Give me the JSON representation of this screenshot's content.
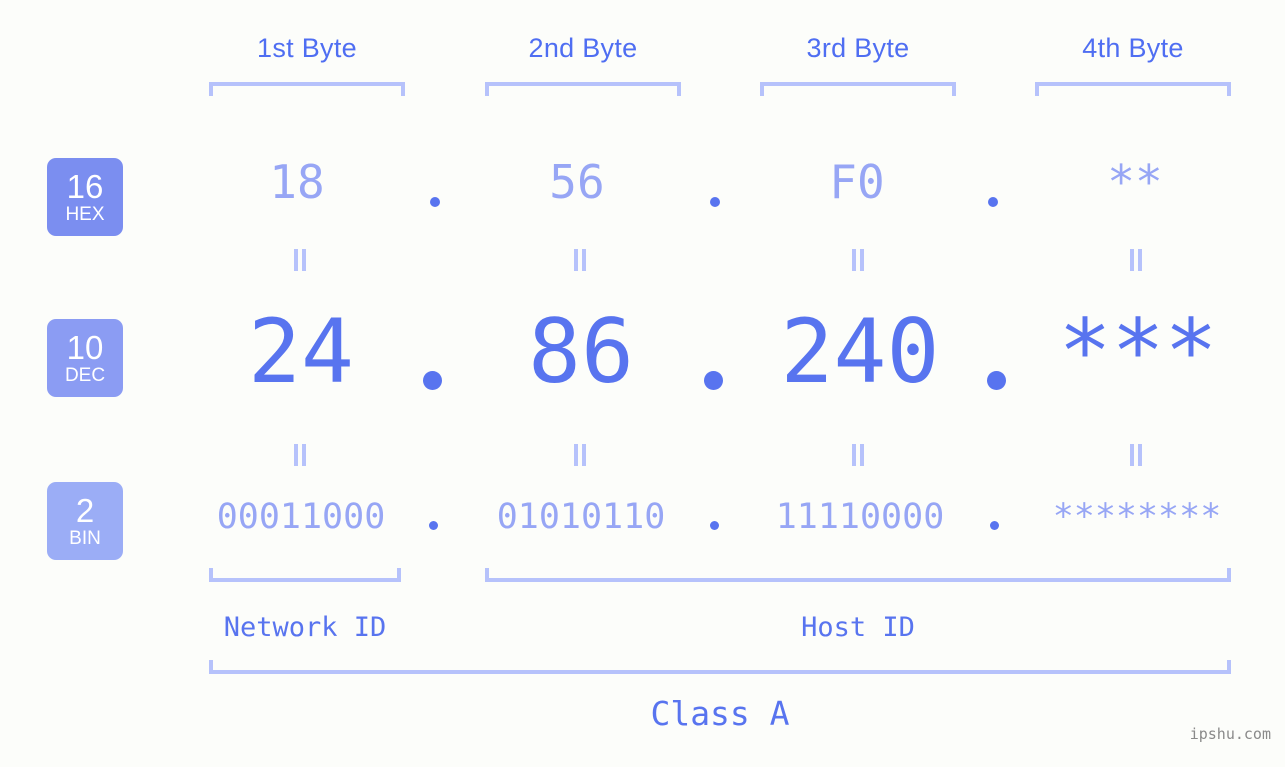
{
  "watermark": "ipshu.com",
  "colors": {
    "background": "#fcfdfa",
    "accent_strong": "#4f6ef2",
    "accent_mid": "#5874ef",
    "accent_light": "#97a6f5",
    "bracket": "#b6c2fb",
    "badge_hex": "#7b8ef0",
    "badge_dec": "#8b9cf3",
    "badge_bin": "#9badf6",
    "watermark_text": "#8a8a8a"
  },
  "byte_headers": [
    {
      "label": "1st Byte"
    },
    {
      "label": "2nd Byte"
    },
    {
      "label": "3rd Byte"
    },
    {
      "label": "4th Byte"
    }
  ],
  "bases": [
    {
      "number": "16",
      "name": "HEX"
    },
    {
      "number": "10",
      "name": "DEC"
    },
    {
      "number": "2",
      "name": "BIN"
    }
  ],
  "rows": {
    "hex": {
      "base": "16",
      "name": "HEX",
      "values": [
        "18",
        "56",
        "F0",
        "**"
      ]
    },
    "dec": {
      "base": "10",
      "name": "DEC",
      "values": [
        "24",
        "86",
        "240",
        "***"
      ]
    },
    "bin": {
      "base": "2",
      "name": "BIN",
      "values": [
        "00011000",
        "01010110",
        "11110000",
        "********"
      ]
    }
  },
  "separator": {
    "glyph": ".",
    "count_per_row": 3
  },
  "equals_marks": {
    "glyph": "‖",
    "rows": 2,
    "columns": 4
  },
  "segments": {
    "network_id": "Network ID",
    "host_id": "Host ID",
    "class": "Class A"
  }
}
